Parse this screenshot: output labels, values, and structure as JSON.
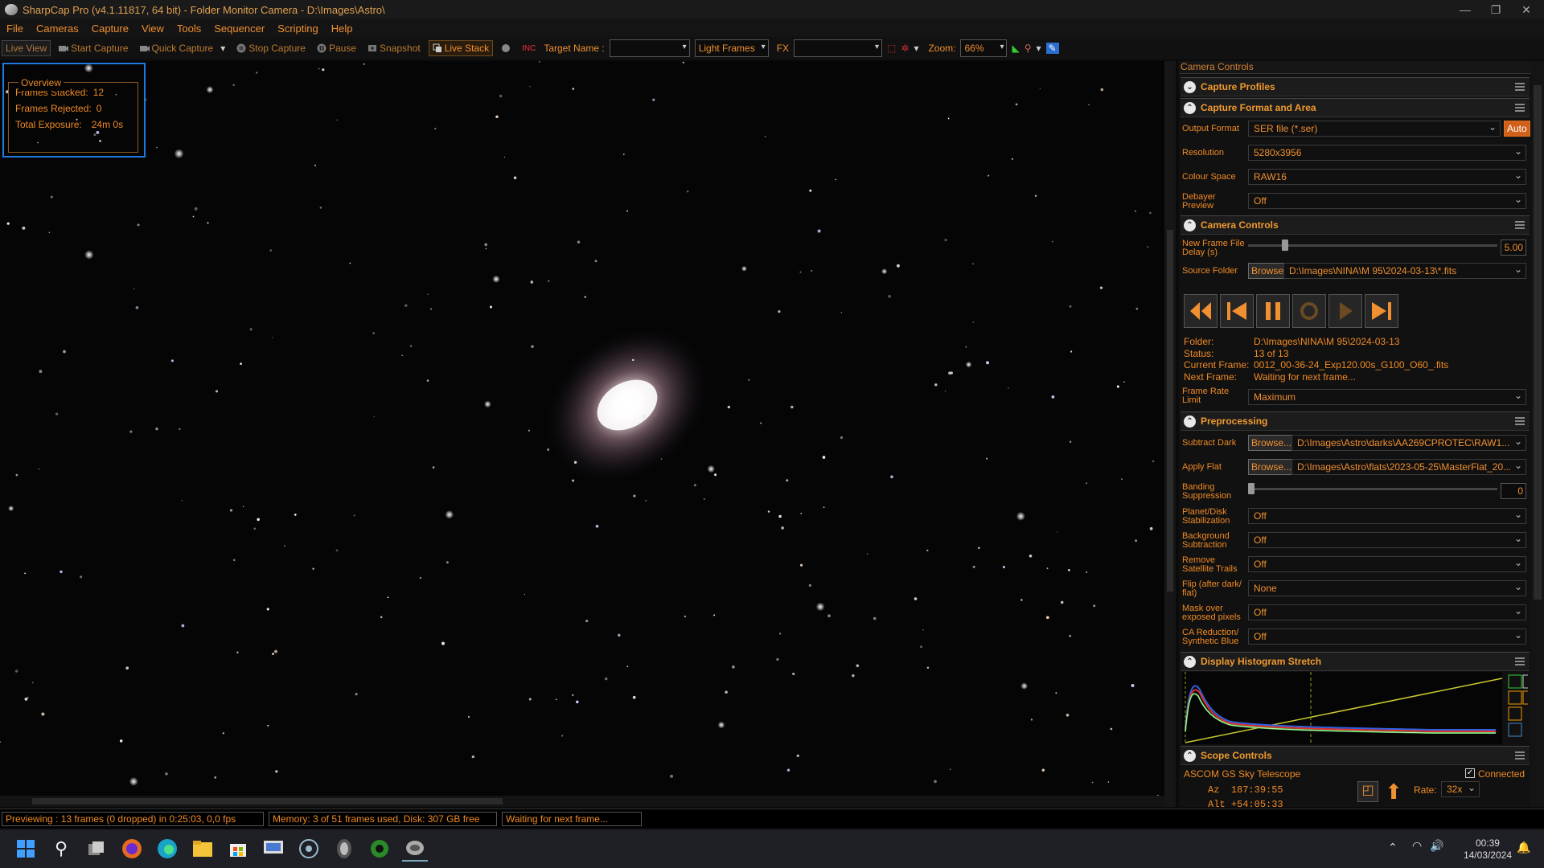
{
  "window": {
    "title": "SharpCap Pro (v4.1.11817, 64 bit) - Folder Monitor Camera - D:\\Images\\Astro\\"
  },
  "menu": [
    "File",
    "Cameras",
    "Capture",
    "View",
    "Tools",
    "Sequencer",
    "Scripting",
    "Help"
  ],
  "toolbar": {
    "live_view": "Live View",
    "start_capture": "Start Capture",
    "quick_capture": "Quick Capture",
    "stop_capture": "Stop Capture",
    "pause": "Pause",
    "snapshot": "Snapshot",
    "live_stack": "Live Stack",
    "target_name_label": "Target Name :",
    "target_name_value": "",
    "frame_type": "Light Frames",
    "fx_label": "FX",
    "fx_value": "",
    "zoom_label": "Zoom:",
    "zoom_value": "66%"
  },
  "overview": {
    "title": "Overview",
    "frames_stacked_label": "Frames Stacked:",
    "frames_stacked": "12",
    "frames_rejected_label": "Frames Rejected:",
    "frames_rejected": "0",
    "total_exposure_label": "Total Exposure:",
    "total_exposure": "24m 0s"
  },
  "panel": {
    "header": "Camera Controls",
    "capture_profiles": "Capture Profiles",
    "capture_format": {
      "title": "Capture Format and Area",
      "output_format_label": "Output Format",
      "output_format": "SER file (*.ser)",
      "auto": "Auto",
      "resolution_label": "Resolution",
      "resolution": "5280x3956",
      "colour_space_label": "Colour Space",
      "colour_space": "RAW16",
      "debayer_label_1": "Debayer",
      "debayer_label_2": "Preview",
      "debayer": "Off"
    },
    "camera_controls": {
      "title": "Camera Controls",
      "delay_label_1": "New Frame File",
      "delay_label_2": "Delay (s)",
      "delay_value": "5.00",
      "delay_level": 0.14,
      "source_folder_label": "Source Folder",
      "browse": "Browse",
      "source_folder": "D:\\Images\\NINA\\M 95\\2024-03-13\\*.fits",
      "folder_label": "Folder:",
      "folder": "D:\\Images\\NINA\\M 95\\2024-03-13",
      "status_label": "Status:",
      "status": "13 of 13",
      "current_frame_label": "Current Frame:",
      "current_frame": "0012_00-36-24_Exp120.00s_G100_O60_.fits",
      "next_frame_label": "Next Frame:",
      "next_frame": "Waiting for next frame...",
      "frame_rate_label_1": "Frame Rate",
      "frame_rate_label_2": "Limit",
      "frame_rate": "Maximum"
    },
    "preprocessing": {
      "title": "Preprocessing",
      "subtract_dark_label": "Subtract Dark",
      "browse": "Browse...",
      "subtract_dark": "D:\\Images\\Astro\\darks\\AA269CPROTEC\\RAW1...",
      "apply_flat_label": "Apply Flat",
      "apply_flat": "D:\\Images\\Astro\\flats\\2023-05-25\\MasterFlat_20...",
      "banding_label_1": "Banding",
      "banding_label_2": "Suppression",
      "banding_value": "0",
      "banding_level": 0,
      "rows": [
        {
          "l1": "Planet/Disk",
          "l2": "Stabilization",
          "v": "Off"
        },
        {
          "l1": "Background",
          "l2": "Subtraction",
          "v": "Off"
        },
        {
          "l1": "Remove",
          "l2": "Satellite Trails",
          "v": "Off"
        },
        {
          "l1": "Flip (after dark/",
          "l2": "flat)",
          "v": "None"
        },
        {
          "l1": "Mask over",
          "l2": "exposed pixels",
          "v": "Off"
        },
        {
          "l1": "CA Reduction/",
          "l2": "Synthetic Blue",
          "v": "Off"
        }
      ]
    },
    "histogram": {
      "title": "Display Histogram Stretch"
    },
    "scope": {
      "title": "Scope Controls",
      "name": "ASCOM GS Sky Telescope",
      "connected": "Connected",
      "az_label": "Az",
      "az": "187:39:55",
      "alt_label": "Alt",
      "alt": "+54:05:33",
      "rate_label": "Rate:",
      "rate": "32x"
    }
  },
  "status": {
    "preview": "Previewing : 13 frames (0 dropped) in 0:25:03, 0,0 fps",
    "memory": "Memory: 3 of 51 frames used, Disk: 307 GB free",
    "state": "Waiting for next frame..."
  },
  "clock": {
    "time": "00:39",
    "date": "14/03/2024"
  }
}
